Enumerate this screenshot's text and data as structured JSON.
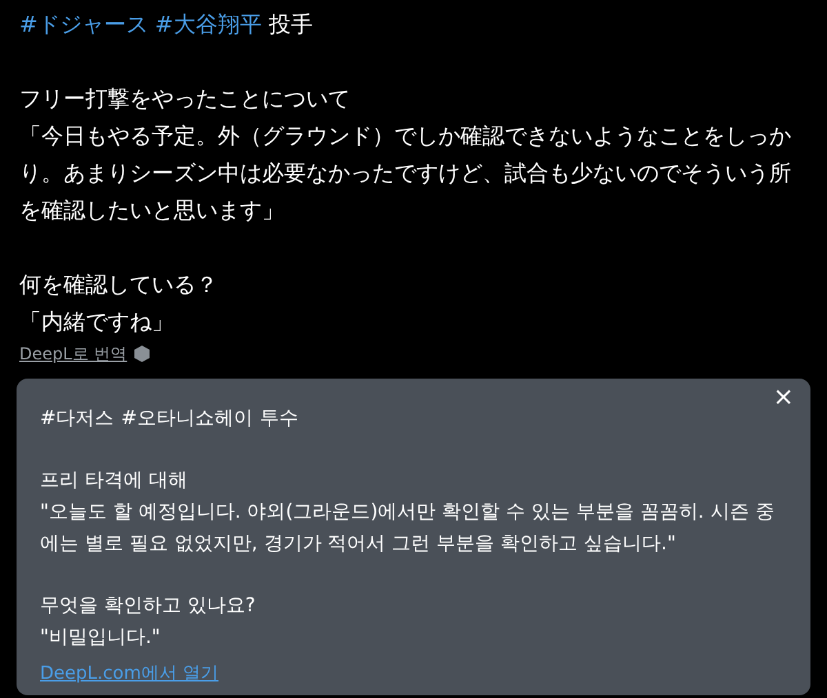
{
  "post": {
    "hashtags": [
      "#ドジャース",
      "#大谷翔平"
    ],
    "role": "投手",
    "blocks": [
      [
        "フリー打撃をやったことについて",
        "「今日もやる予定。外（グラウンド）でしか確認できないようなことをしっかり。あまりシーズン中は必要なかったですけど、試合も少ないのでそういう所を確認したいと思います」"
      ],
      [
        "何を確認している？",
        "「内緒ですね」"
      ]
    ]
  },
  "translate_link": "DeepL로 번역",
  "translation": {
    "close": "×",
    "hashtags": [
      "#다저스",
      "#오타니쇼헤이"
    ],
    "role": "투수",
    "blocks": [
      [
        "프리 타격에 대해",
        "\"오늘도 할 예정입니다. 야외(그라운드)에서만 확인할 수 있는 부분을 꼼꼼히. 시즌 중에는 별로 필요 없었지만, 경기가 적어서 그런 부분을 확인하고 싶습니다.\""
      ],
      [
        "무엇을 확인하고 있나요?",
        "\"비밀입니다.\""
      ]
    ],
    "link": "DeepL.com에서 열기"
  }
}
